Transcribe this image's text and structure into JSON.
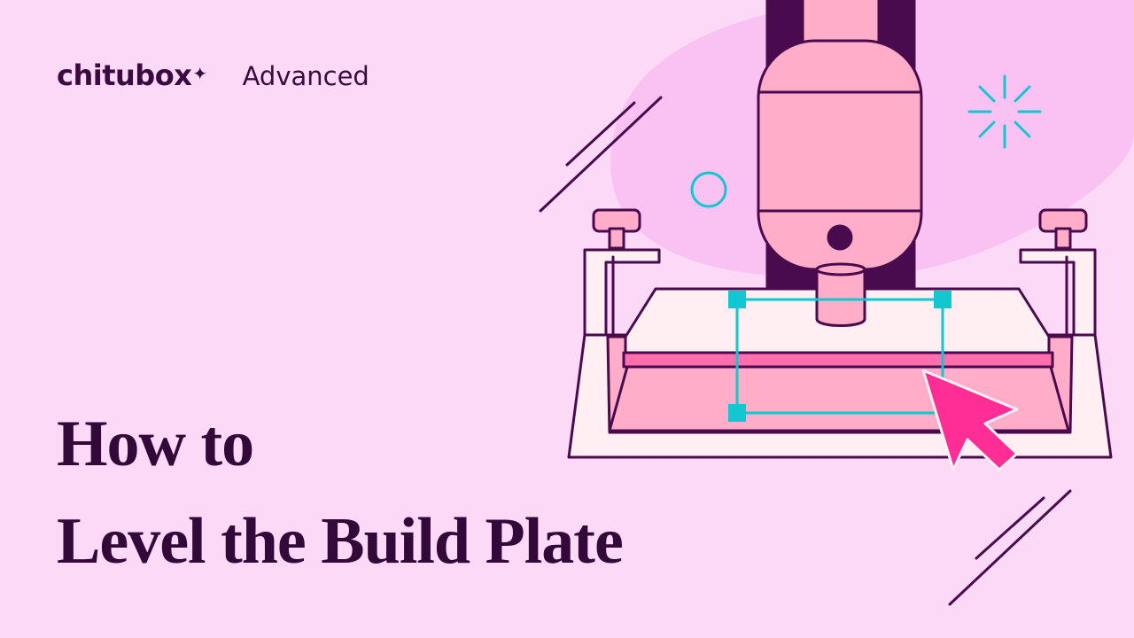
{
  "brand": {
    "logo_text": "chitubox",
    "edition": "Advanced"
  },
  "title": {
    "line1": "How to",
    "line2": "Level the Build Plate"
  },
  "illustration": {
    "subject": "resin-3d-printer-build-plate",
    "cursor_icon": "arrow-cursor-icon",
    "sparkle_icon": "sparkle-icon"
  },
  "colors": {
    "background": "#fcd9f6",
    "blob": "#f9c2f2",
    "outline": "#4a0a4e",
    "pink_body": "#ffadc9",
    "plate_light": "#ffeef2",
    "accent_pink": "#ff2e96",
    "accent_cyan": "#12c7d0",
    "title_text": "#33093a"
  }
}
